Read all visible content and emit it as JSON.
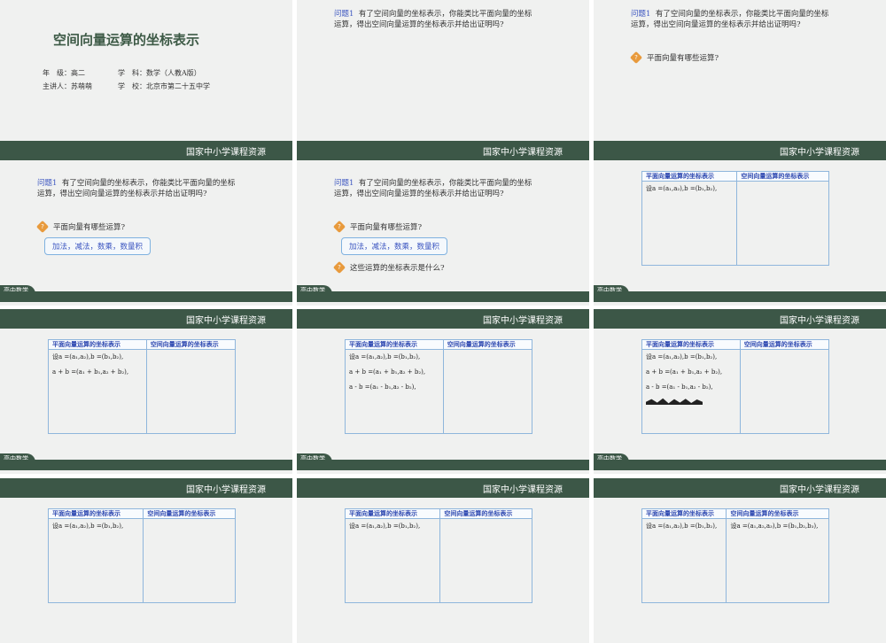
{
  "brand": "国家中小学课程资源",
  "footer_label": "高中数学",
  "cover": {
    "title": "空间向量运算的坐标表示",
    "grade_label": "年　级：高二",
    "subject_label": "学　科：数学（人教A版）",
    "speaker_label": "主讲人：苏萌萌",
    "school_label": "学　校：北京市第二十五中学"
  },
  "question": {
    "tag": "问题1",
    "text": "有了空间向量的坐标表示，你能类比平面向量的坐标运算，得出空间向量运算的坐标表示并给出证明吗?"
  },
  "bullet1": "平面向量有哪些运算?",
  "answer1": "加法，减法，数乘，数量积",
  "bullet2": "这些运算的坐标表示是什么?",
  "diamond_glyph": "?",
  "table": {
    "col1": "平面向量运算的坐标表示",
    "col2": "空间向量运算的坐标表示",
    "row_set": "设a =(a₁,a₂),b =(b₁,b₂),",
    "row_add": "a + b =(a₁ + b₁,a₂ + b₂),",
    "row_sub": "a - b =(a₁ - b₁,a₂ - b₂),",
    "row_set_partial": "设a =(a₁,a₂),b =(b₁,b₂),",
    "row_set_space": "设a =(a₁,a₂,a₃),b =(b₁,b₂,b₃),"
  }
}
